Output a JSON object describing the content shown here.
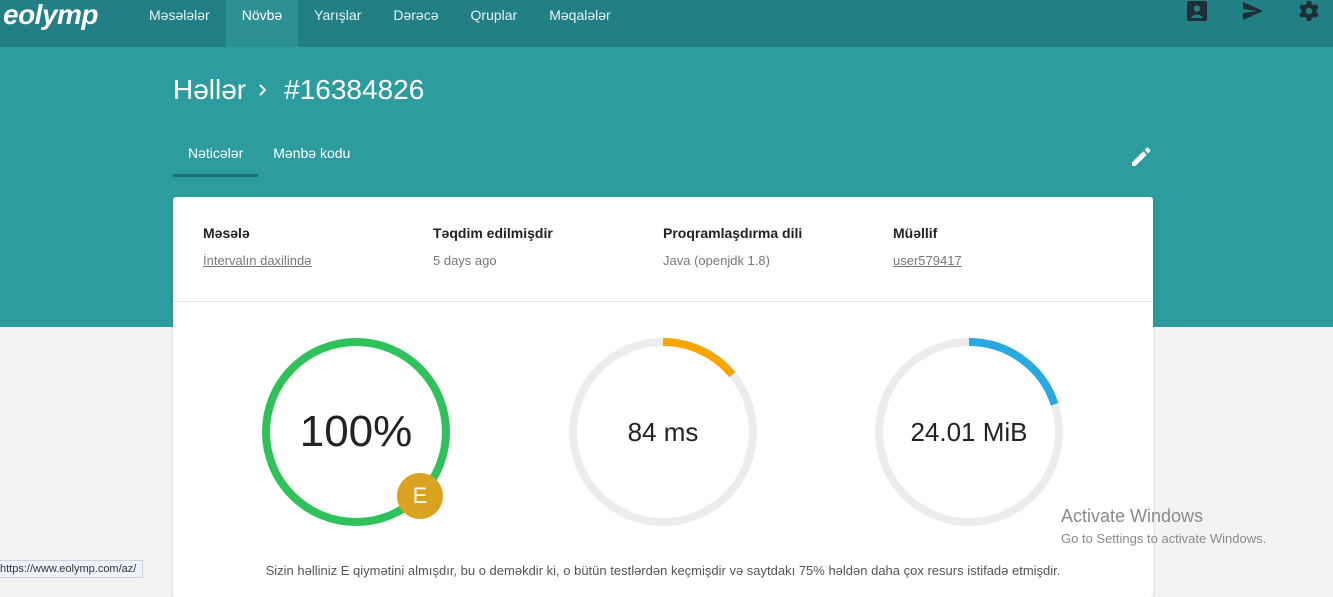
{
  "header": {
    "logo": "eolymp",
    "nav": [
      "Məsələlər",
      "Növbə",
      "Yarışlar",
      "Dərəcə",
      "Qruplar",
      "Məqalələr"
    ],
    "active_nav": "Növbə",
    "icons": [
      "account-box-icon",
      "send-icon",
      "gear-icon"
    ]
  },
  "breadcrumb": {
    "parent": "Həllər",
    "current": "#16384826"
  },
  "tabs": {
    "results": "Nəticələr",
    "source": "Mənbə kodu"
  },
  "info": {
    "problem": {
      "label": "Məsələ",
      "value": "İntervalın daxilində"
    },
    "submitted": {
      "label": "Təqdim edilmişdir",
      "value": "5 days ago"
    },
    "language": {
      "label": "Proqramlaşdırma dili",
      "value": "Java (openjdk 1.8)"
    },
    "author": {
      "label": "Müəllif",
      "value": "user579417"
    }
  },
  "gauges": {
    "score": {
      "text": "100%",
      "fraction": 1.0,
      "color": "#2fc25a",
      "grade": "E",
      "grade_color": "#d9a221"
    },
    "time": {
      "text": "84 ms",
      "fraction": 0.14,
      "color": "#f7a600"
    },
    "memory": {
      "text": "24.01 MiB",
      "fraction": 0.2,
      "color": "#2aa9e0"
    },
    "track_color": "#ececec"
  },
  "summary": "Sizin həlliniz E qiymətini almışdır, bu o deməkdir ki, o bütün testlərdən keçmişdir və saytdakı 75% həldən daha çox resurs istifadə etmişdir.",
  "status_url": "https://www.eolymp.com/az/",
  "watermark": {
    "title": "Activate Windows",
    "subtitle": "Go to Settings to activate Windows."
  },
  "colors": {
    "topbar": "#237f86",
    "hero": "#2c9c9f",
    "active_tab_underline": "#1d6e72"
  }
}
